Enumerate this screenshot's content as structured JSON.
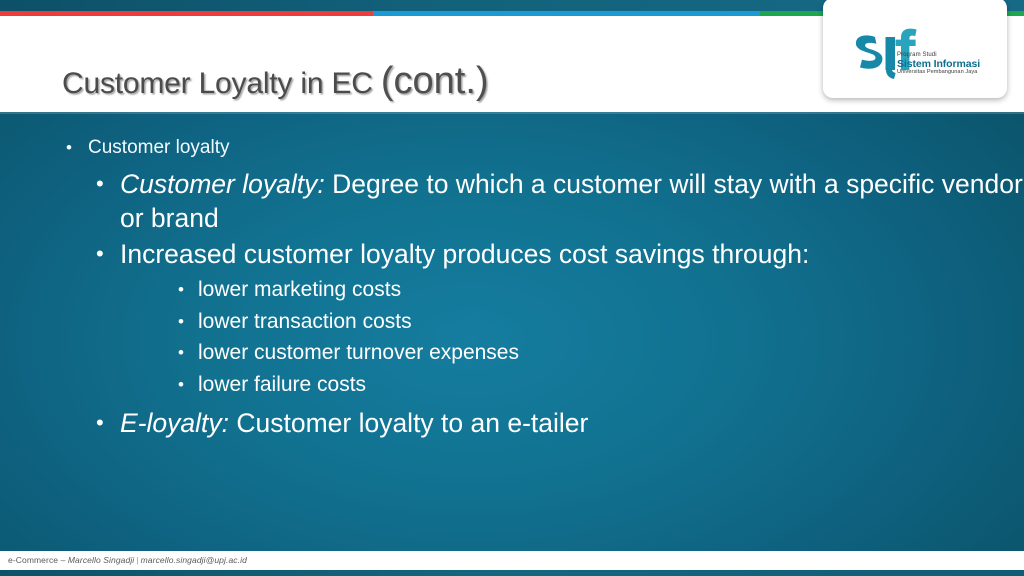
{
  "slide": {
    "title_main": "Customer Loyalty in EC ",
    "title_cont": "(cont.)",
    "colors": {
      "stripe_red": "#ed3c3c",
      "stripe_blue": "#1b9ad6",
      "stripe_green": "#1da84f",
      "top_band": "#12627c",
      "body_teal": "#11718f",
      "body_teal_dark": "#0b5268",
      "title_text": "#4b4b4b",
      "body_text": "#ffffff",
      "logo_teal": "#1789a8",
      "footer_text": "#5a5a5a"
    }
  },
  "logo": {
    "mark_label": "SIf",
    "line1": "Program Studi",
    "line2": "Sistem Informasi",
    "line3": "Universitas Pembangunan Jaya"
  },
  "content": {
    "bullet_char": "•",
    "level1": [
      {
        "text": "Customer loyalty"
      }
    ],
    "level2": [
      {
        "emphasis": "Customer loyalty:",
        "text": " Degree to which a customer will stay with a specific vendor or brand"
      },
      {
        "emphasis": "",
        "text": "Increased customer loyalty produces cost savings through:"
      },
      {
        "emphasis": "E-loyalty:",
        "text": " Customer loyalty to an e-tailer"
      }
    ],
    "level3": [
      {
        "text": "lower marketing costs"
      },
      {
        "text": "lower transaction costs"
      },
      {
        "text": "lower customer turnover expenses"
      },
      {
        "text": "lower failure costs"
      }
    ]
  },
  "footer": {
    "course": "e-Commerce – ",
    "author": "Marcello Singadji",
    "separator": "|",
    "email": "marcello.singadji@upj.ac.id"
  }
}
